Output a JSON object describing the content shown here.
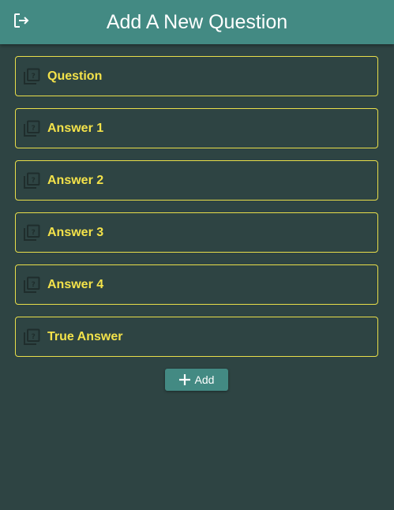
{
  "header": {
    "title": "Add A New Question",
    "logout_icon": "logout-icon"
  },
  "form": {
    "fields": [
      {
        "label": "Question",
        "icon": "question-library-icon"
      },
      {
        "label": "Answer 1",
        "icon": "question-library-icon"
      },
      {
        "label": "Answer 2",
        "icon": "question-library-icon"
      },
      {
        "label": "Answer 3",
        "icon": "question-library-icon"
      },
      {
        "label": "Answer 4",
        "icon": "question-library-icon"
      },
      {
        "label": "True Answer",
        "icon": "question-library-icon"
      }
    ]
  },
  "actions": {
    "add_label": "Add",
    "add_icon": "plus-icon"
  },
  "colors": {
    "background": "#2e4443",
    "appbar": "#438a83",
    "field_border": "#e8de4a",
    "field_label": "#f3e24a",
    "icon": "#1f2d2c"
  }
}
